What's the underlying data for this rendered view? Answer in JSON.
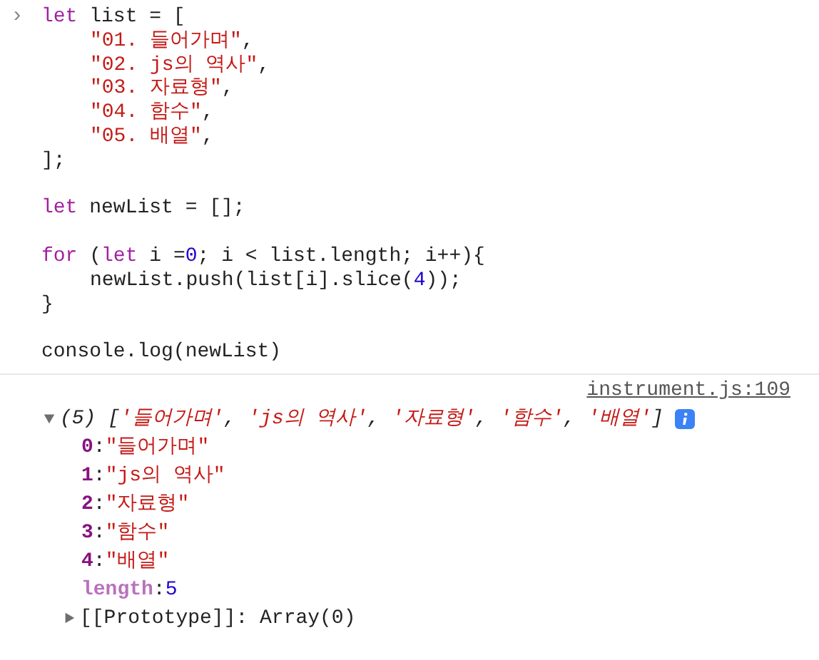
{
  "input": {
    "prompt": "›",
    "lines": [
      {
        "kind": "code",
        "indented": false,
        "tokens": [
          {
            "kind": "keyword",
            "text": "let"
          },
          {
            "kind": "plain",
            "text": " list = ["
          }
        ]
      },
      {
        "kind": "code",
        "indented": true,
        "tokens": [
          {
            "kind": "string",
            "text": "\"01. 들어가며\""
          },
          {
            "kind": "plain",
            "text": ","
          }
        ]
      },
      {
        "kind": "code",
        "indented": true,
        "tokens": [
          {
            "kind": "string",
            "text": "\"02. js의 역사\""
          },
          {
            "kind": "plain",
            "text": ","
          }
        ]
      },
      {
        "kind": "code",
        "indented": true,
        "tokens": [
          {
            "kind": "string",
            "text": "\"03. 자료형\""
          },
          {
            "kind": "plain",
            "text": ","
          }
        ]
      },
      {
        "kind": "code",
        "indented": true,
        "tokens": [
          {
            "kind": "string",
            "text": "\"04. 함수\""
          },
          {
            "kind": "plain",
            "text": ","
          }
        ]
      },
      {
        "kind": "code",
        "indented": true,
        "tokens": [
          {
            "kind": "string",
            "text": "\"05. 배열\""
          },
          {
            "kind": "plain",
            "text": ","
          }
        ]
      },
      {
        "kind": "code",
        "indented": false,
        "tokens": [
          {
            "kind": "plain",
            "text": "];"
          }
        ]
      },
      {
        "kind": "blank"
      },
      {
        "kind": "code",
        "indented": false,
        "tokens": [
          {
            "kind": "keyword",
            "text": "let"
          },
          {
            "kind": "plain",
            "text": " newList = [];"
          }
        ]
      },
      {
        "kind": "blank"
      },
      {
        "kind": "code",
        "indented": false,
        "tokens": [
          {
            "kind": "keyword",
            "text": "for"
          },
          {
            "kind": "plain",
            "text": " ("
          },
          {
            "kind": "keyword",
            "text": "let"
          },
          {
            "kind": "plain",
            "text": " i ="
          },
          {
            "kind": "number",
            "text": "0"
          },
          {
            "kind": "plain",
            "text": "; i < list.length; i++){"
          }
        ]
      },
      {
        "kind": "code",
        "indented": true,
        "tokens": [
          {
            "kind": "plain",
            "text": "newList.push(list[i].slice("
          },
          {
            "kind": "number",
            "text": "4"
          },
          {
            "kind": "plain",
            "text": "));"
          }
        ]
      },
      {
        "kind": "code",
        "indented": false,
        "tokens": [
          {
            "kind": "plain",
            "text": "}"
          }
        ]
      },
      {
        "kind": "blank"
      },
      {
        "kind": "code",
        "indented": false,
        "tokens": [
          {
            "kind": "plain",
            "text": "console.log(newList)"
          }
        ]
      }
    ]
  },
  "output": {
    "source": "instrument.js:109",
    "expanded": true,
    "preview": [
      {
        "kind": "punct",
        "text": "(5) ["
      },
      {
        "kind": "string",
        "text": "'들어가며'"
      },
      {
        "kind": "punct",
        "text": ", "
      },
      {
        "kind": "string",
        "text": "'js의 역사'"
      },
      {
        "kind": "punct",
        "text": ", "
      },
      {
        "kind": "string",
        "text": "'자료형'"
      },
      {
        "kind": "punct",
        "text": ", "
      },
      {
        "kind": "string",
        "text": "'함수'"
      },
      {
        "kind": "punct",
        "text": ", "
      },
      {
        "kind": "string",
        "text": "'배열'"
      },
      {
        "kind": "punct",
        "text": "]"
      }
    ],
    "entries": [
      {
        "kind": "index",
        "key": "0",
        "sep": ":",
        "value": "\"들어가며\""
      },
      {
        "kind": "index",
        "key": "1",
        "sep": ":",
        "value": "\"js의 역사\""
      },
      {
        "kind": "index",
        "key": "2",
        "sep": ":",
        "value": "\"자료형\""
      },
      {
        "kind": "index",
        "key": "3",
        "sep": ":",
        "value": "\"함수\""
      },
      {
        "kind": "index",
        "key": "4",
        "sep": ":",
        "value": "\"배열\""
      },
      {
        "kind": "length",
        "key": "length",
        "sep": ":",
        "value": "5"
      }
    ],
    "prototype": {
      "key": "[[Prototype]]",
      "sep": ":",
      "value": "Array(0)",
      "expanded": false
    }
  }
}
